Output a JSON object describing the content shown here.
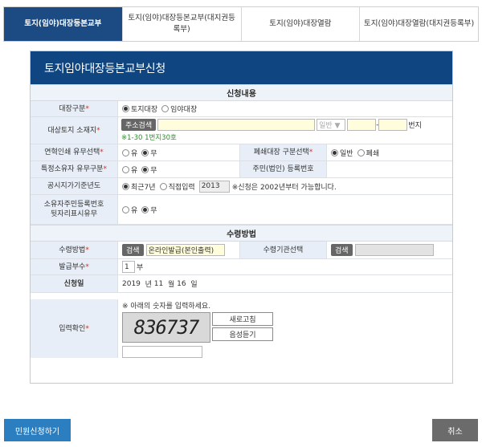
{
  "tabs": [
    {
      "label": "토지(임야)대장등본교부",
      "active": true
    },
    {
      "label": "토지(임야)대장등본교부(대지권등록부)",
      "active": false
    },
    {
      "label": "토지(임야)대장열람",
      "active": false
    },
    {
      "label": "토지(임야)대장열람(대지권등록부)",
      "active": false
    }
  ],
  "panel": {
    "title": "토지임야대장등본교부신청"
  },
  "section1": "신청내용",
  "section2": "수령방법",
  "req_mark": "*",
  "fields": {
    "ledger_type": {
      "label": "대장구분",
      "options": [
        "토지대장",
        "임야대장"
      ],
      "selected": 0
    },
    "address": {
      "label": "대상토지 소재지",
      "search_btn": "주소검색",
      "bunji_select": "일반 ▼",
      "dash": "-",
      "suffix": "번지",
      "hint": "※1-30 1번지30호"
    },
    "history": {
      "label": "연혁인쇄 유무선택",
      "options": [
        "유",
        "무"
      ],
      "selected": 1
    },
    "closed": {
      "label": "폐쇄대장 구분선택",
      "options": [
        "일반",
        "폐쇄"
      ],
      "selected": 0
    },
    "owner": {
      "label": "특정소유자 유무구분",
      "options": [
        "유",
        "무"
      ],
      "selected": 1
    },
    "resident_no": {
      "label": "주민(법인) 등록번호"
    },
    "price_year": {
      "label": "공시지가기준년도",
      "options": [
        "최근7년",
        "직접입력"
      ],
      "selected": 0,
      "year": "2013",
      "note": "※신청은 2002년부터 가능합니다."
    },
    "resident_show": {
      "label_line1": "소유자주민등록번호",
      "label_line2": "뒷자리표시유무",
      "options": [
        "유",
        "무"
      ],
      "selected": 1
    },
    "receive_method": {
      "label": "수령방법",
      "search_btn": "검색",
      "value": "온라인발급(본인출력)"
    },
    "receive_org": {
      "label": "수령기관선택",
      "search_btn": "검색"
    },
    "copies": {
      "label": "발급부수",
      "value": "1",
      "unit": "부"
    },
    "apply_date": {
      "label": "신청일",
      "year": "2019",
      "year_unit": "년",
      "month": "11",
      "month_unit": "월",
      "day": "16",
      "day_unit": "일"
    },
    "captcha": {
      "label": "입력확인",
      "instruction": "※ 아래의 숫자를 입력하세요.",
      "code": "836737",
      "refresh": "새로고침",
      "audio": "음성듣기"
    }
  },
  "buttons": {
    "submit": "민원신청하기",
    "cancel": "취소"
  }
}
